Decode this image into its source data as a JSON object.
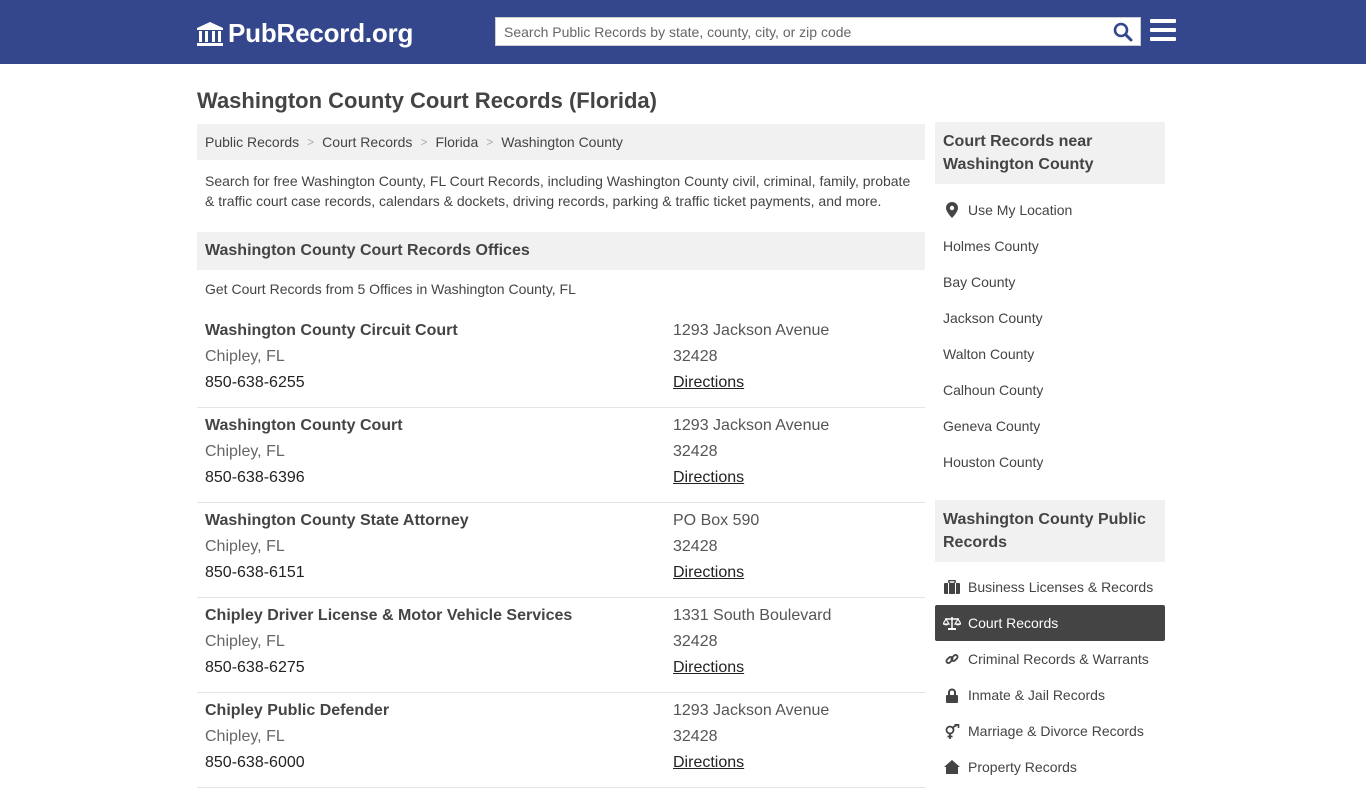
{
  "header": {
    "logo_text": "PubRecord.org",
    "search_placeholder": "Search Public Records by state, county, city, or zip code",
    "search_value": ""
  },
  "page_title": "Washington County Court Records (Florida)",
  "breadcrumb": [
    "Public Records",
    "Court Records",
    "Florida",
    "Washington County"
  ],
  "intro": "Search for free Washington County, FL Court Records, including Washington County civil, criminal, family, probate & traffic court case records, calendars & dockets, driving records, parking & traffic ticket payments, and more.",
  "offices_section": {
    "heading": "Washington County Court Records Offices",
    "subtext": "Get Court Records from 5 Offices in Washington County, FL",
    "directions_label": "Directions",
    "items": [
      {
        "name": "Washington County Circuit Court",
        "city": "Chipley, FL",
        "phone": "850-638-6255",
        "address": "1293 Jackson Avenue",
        "zip": "32428"
      },
      {
        "name": "Washington County Court",
        "city": "Chipley, FL",
        "phone": "850-638-6396",
        "address": "1293 Jackson Avenue",
        "zip": "32428"
      },
      {
        "name": "Washington County State Attorney",
        "city": "Chipley, FL",
        "phone": "850-638-6151",
        "address": "PO Box 590",
        "zip": "32428"
      },
      {
        "name": "Chipley Driver License & Motor Vehicle Services",
        "city": "Chipley, FL",
        "phone": "850-638-6275",
        "address": "1331 South Boulevard",
        "zip": "32428"
      },
      {
        "name": "Chipley Public Defender",
        "city": "Chipley, FL",
        "phone": "850-638-6000",
        "address": "1293 Jackson Avenue",
        "zip": "32428"
      }
    ]
  },
  "sidebar": {
    "nearby_heading": "Court Records near Washington County",
    "use_location": "Use My Location",
    "nearby": [
      "Holmes County",
      "Bay County",
      "Jackson County",
      "Walton County",
      "Calhoun County",
      "Geneva County",
      "Houston County"
    ],
    "public_heading": "Washington County Public Records",
    "public_items": [
      {
        "label": "Business Licenses & Records",
        "icon": "briefcase-icon"
      },
      {
        "label": "Court Records",
        "icon": "scale-icon",
        "active": true
      },
      {
        "label": "Criminal Records & Warrants",
        "icon": "link-icon"
      },
      {
        "label": "Inmate & Jail Records",
        "icon": "lock-icon"
      },
      {
        "label": "Marriage & Divorce Records",
        "icon": "gender-icon"
      },
      {
        "label": "Property Records",
        "icon": "home-icon"
      }
    ]
  },
  "colors": {
    "header_bg": "#34478d",
    "panel_bg": "#f1f1f1",
    "active_bg": "#444444"
  }
}
